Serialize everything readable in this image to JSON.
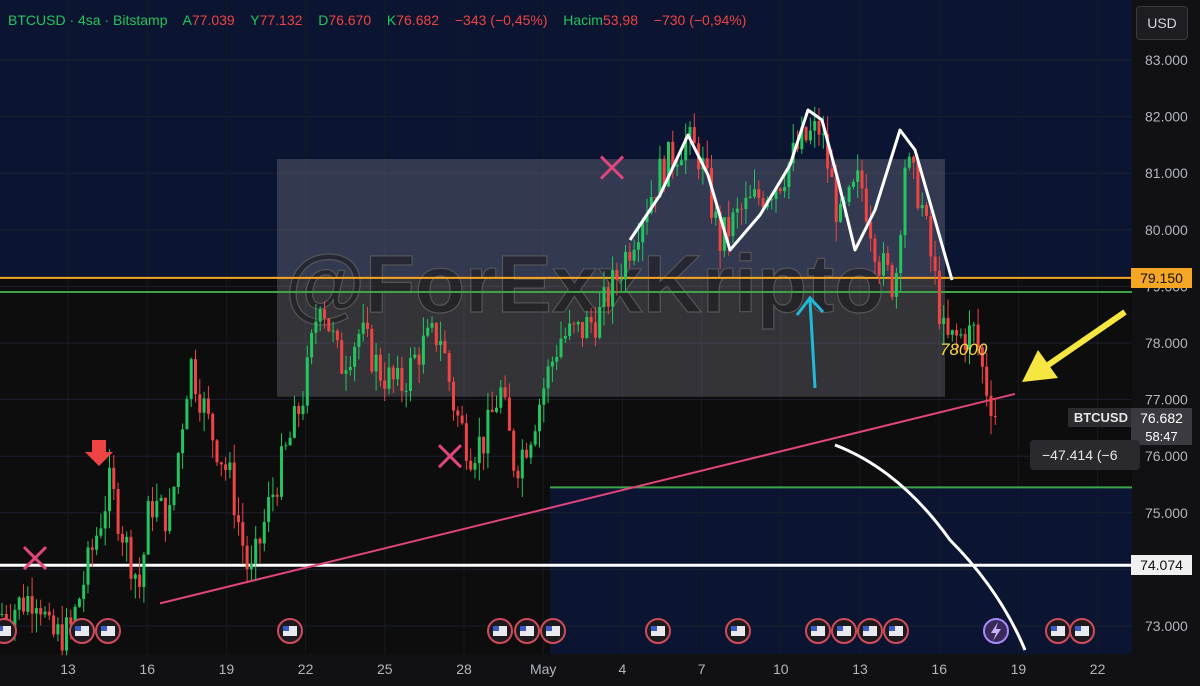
{
  "header": {
    "symbol": "BTCUSD",
    "interval": "4sa",
    "exchange": "Bitstamp",
    "open_label": "A",
    "open_value": "77.039",
    "high_label": "Y",
    "high_value": "77.132",
    "low_label": "D",
    "low_value": "76.670",
    "close_label": "K",
    "close_value": "76.682",
    "change": "−343 (−0,45%)",
    "volume_label": "Hacim",
    "volume_value": "53,98",
    "volume_change": "−730 (−0,94%)"
  },
  "currency_button": "USD",
  "watermark": "@ForExxKripto",
  "price_pills": {
    "orange_level": "79.150",
    "white_level": "74.074",
    "symbol_tag": "BTCUSD",
    "last_price": "76.682",
    "countdown": "58:47"
  },
  "measure_label": "−47.414 (−6",
  "annotation_78": "78000",
  "colors": {
    "up": "#22c55e",
    "down": "#ef4444",
    "orange_line": "#f5a623",
    "trend_line": "#e0457b",
    "green_line": "#3ea34a",
    "white_line": "#ffffff",
    "arrow_yellow": "#f5e642",
    "arrow_cyan": "#22b8d8",
    "x_mark": "#e0457b"
  },
  "chart_data": {
    "type": "candlestick",
    "y_axis": {
      "min": 72.7,
      "max": 83.2,
      "ticks": [
        "83.000",
        "82.000",
        "81.000",
        "80.000",
        "79.000",
        "78.000",
        "77.000",
        "76.000",
        "75.000",
        "74.000",
        "73.000"
      ]
    },
    "x_axis": {
      "ticks": [
        "13",
        "16",
        "19",
        "22",
        "25",
        "28",
        "May",
        "4",
        "7",
        "10",
        "13",
        "16",
        "19",
        "22"
      ]
    },
    "overlays": {
      "orange_line_price": 79.15,
      "white_line_price": 74.074,
      "green_line_upper": 78.9,
      "green_line_lower": 75.45,
      "trend_line": [
        [
          160,
          73.4
        ],
        [
          1015,
          77.1
        ]
      ],
      "gray_box_price_range": [
        77.05,
        81.25
      ],
      "blue_zone_top": 75.45
    },
    "candles_close_path": [
      [
        0,
        73.2
      ],
      [
        20,
        73.4
      ],
      [
        38,
        73.6
      ],
      [
        50,
        72.8
      ],
      [
        70,
        72.9
      ],
      [
        90,
        74.2
      ],
      [
        110,
        75.5
      ],
      [
        125,
        74.5
      ],
      [
        140,
        73.7
      ],
      [
        150,
        75.2
      ],
      [
        170,
        74.9
      ],
      [
        190,
        77.7
      ],
      [
        210,
        76.5
      ],
      [
        230,
        75.6
      ],
      [
        250,
        73.8
      ],
      [
        270,
        75.2
      ],
      [
        290,
        76.3
      ],
      [
        305,
        77.2
      ],
      [
        320,
        78.9
      ],
      [
        340,
        77.6
      ],
      [
        360,
        78.2
      ],
      [
        380,
        77.5
      ],
      [
        400,
        77.2
      ],
      [
        420,
        77.9
      ],
      [
        440,
        78.2
      ],
      [
        455,
        76.8
      ],
      [
        470,
        76.1
      ],
      [
        485,
        76.3
      ],
      [
        500,
        77.2
      ],
      [
        515,
        75.8
      ],
      [
        530,
        76.4
      ],
      [
        545,
        77.3
      ],
      [
        560,
        78.1
      ],
      [
        580,
        78.2
      ],
      [
        600,
        78.5
      ],
      [
        620,
        79.3
      ],
      [
        640,
        80.2
      ],
      [
        660,
        81.0
      ],
      [
        685,
        81.6
      ],
      [
        700,
        81.3
      ],
      [
        720,
        79.8
      ],
      [
        740,
        80.3
      ],
      [
        760,
        80.6
      ],
      [
        780,
        80.9
      ],
      [
        800,
        81.5
      ],
      [
        820,
        81.8
      ],
      [
        840,
        80.1
      ],
      [
        860,
        80.9
      ],
      [
        880,
        79.4
      ],
      [
        895,
        79.0
      ],
      [
        905,
        81.2
      ],
      [
        920,
        80.6
      ],
      [
        935,
        79.1
      ],
      [
        945,
        78.0
      ],
      [
        960,
        78.1
      ],
      [
        975,
        78.2
      ],
      [
        985,
        77.3
      ],
      [
        997,
        76.68
      ]
    ],
    "x_marks_price": [
      [
        35,
        74.2
      ],
      [
        612,
        81.1
      ],
      [
        450,
        76.0
      ]
    ]
  }
}
